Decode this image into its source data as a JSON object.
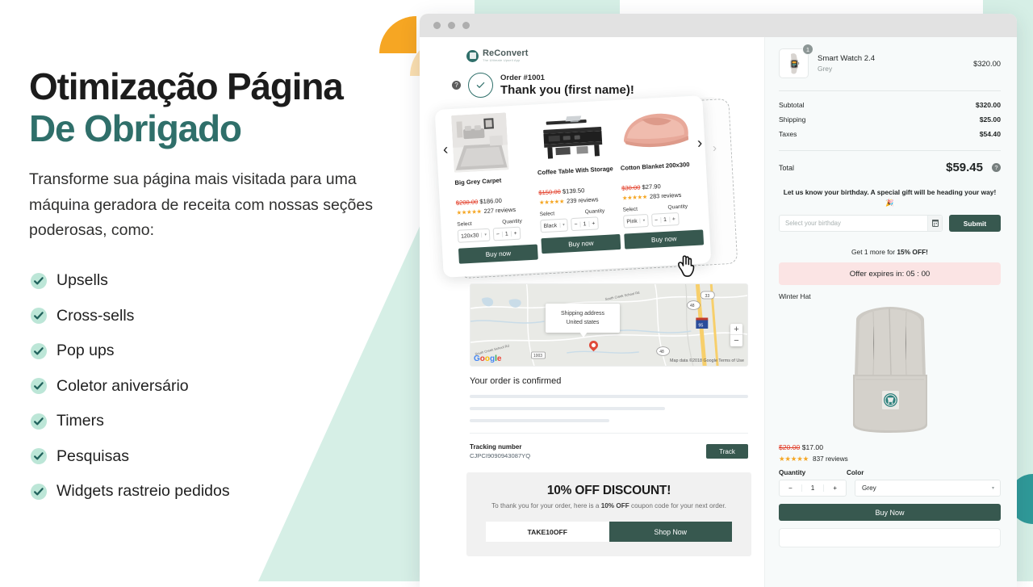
{
  "colors": {
    "teal": "#2f6f6a",
    "dark_green_button": "#37584f",
    "mint_bg": "#d6efe6",
    "ochre": "#f6a623",
    "ochre_light": "#fbdfb0",
    "teal_accent": "#2f9a99",
    "sale_red": "#e23b26",
    "star_orange": "#f5a623",
    "offer_pink": "#fbe4e4"
  },
  "marketing": {
    "headline_line1": "Otimização Página",
    "headline_line2": "De Obrigado",
    "subcopy": "Transforme sua página mais visitada para uma máquina geradora de receita com nossas seções poderosas, como:",
    "features": [
      {
        "label": "Upsells",
        "icon": "check-icon"
      },
      {
        "label": "Cross-sells",
        "icon": "check-icon"
      },
      {
        "label": "Pop ups",
        "icon": "check-icon"
      },
      {
        "label": "Coletor aniversário",
        "icon": "check-icon"
      },
      {
        "label": "Timers",
        "icon": "check-icon"
      },
      {
        "label": "Pesquisas",
        "icon": "check-icon"
      },
      {
        "label": "Widgets rastreio pedidos",
        "icon": "check-icon"
      }
    ]
  },
  "browser": {
    "chrome_dots": 3
  },
  "thankyou_page": {
    "brand": {
      "name": "ReConvert",
      "tagline": "The Ultimate Upsell App"
    },
    "help_icon": "question-mark-icon",
    "status_icon": "check-circle-icon",
    "order_number": "Order #1001",
    "thank_you_heading": "Thank you (first name)!",
    "carousel": {
      "prev_label": "‹",
      "next_label": "›",
      "ghost_next_label": "›",
      "products": [
        {
          "name": "Big Grey Carpet",
          "price_was": "$200.00",
          "price_now": "$186.00",
          "stars": "★★★★★",
          "reviews": "227 reviews",
          "select_label": "Select",
          "select_value": "120x30",
          "quantity_label": "Quantity",
          "quantity_value": "1",
          "minus": "−",
          "plus": "+",
          "buy_label": "Buy now",
          "image": "grey-carpet-room-photo"
        },
        {
          "name": "Coffee Table With Storage",
          "price_was": "$150.00",
          "price_now": "$139.50",
          "stars": "★★★★★",
          "reviews": "239 reviews",
          "select_label": "Select",
          "select_value": "Black",
          "quantity_label": "Quantity",
          "quantity_value": "1",
          "minus": "−",
          "plus": "+",
          "buy_label": "Buy now",
          "image": "black-coffee-table-photo"
        },
        {
          "name": "Cotton Blanket 200x300",
          "price_was": "$30.00",
          "price_now": "$27.90",
          "stars": "★★★★★",
          "reviews": "283 reviews",
          "select_label": "Select",
          "select_value": "Pink",
          "quantity_label": "Quantity",
          "quantity_value": "1",
          "minus": "−",
          "plus": "+",
          "buy_label": "Buy now",
          "image": "pink-folded-blanket-photo"
        }
      ]
    },
    "map": {
      "callout_line1": "Shipping address",
      "callout_line2": "United states",
      "logo": "Google",
      "attribution": "Map data ©2018 Google      Terms of Use",
      "zoom_in": "+",
      "zoom_out": "−",
      "pin_icon": "map-pin-icon"
    },
    "confirmation": {
      "title": "Your order is confirmed",
      "tracking_label": "Tracking number",
      "tracking_code": "CJPCI9090943087YQ",
      "track_button": "Track"
    },
    "discount": {
      "title": "10% OFF DISCOUNT!",
      "sub_pre": "To thank you for your order, here is a ",
      "sub_bold": "10% OFF",
      "sub_post": " coupon code for your next order.",
      "coupon_code": "TAKE10OFF",
      "shop_button": "Shop Now"
    }
  },
  "order_summary": {
    "line_item": {
      "badge_qty": "1",
      "name": "Smart Watch 2.4",
      "variant": "Grey",
      "price": "$320.00",
      "image": "smart-watch-photo"
    },
    "totals": [
      {
        "key": "Subtotal",
        "value": "$320.00"
      },
      {
        "key": "Shipping",
        "value": "$25.00"
      },
      {
        "key": "Taxes",
        "value": "$54.40"
      }
    ],
    "total_label": "Total",
    "total_value": "$59.45",
    "total_info_icon": "question-mark-icon",
    "birthday": {
      "copy": "Let us know your birthday. A special gift will be heading your way! 🎉",
      "placeholder": "Select your birthday",
      "calendar_icon": "calendar-icon",
      "submit_label": "Submit"
    },
    "upsell": {
      "get_more_pre": "Get 1 more for ",
      "get_more_bold": "15% OFF!",
      "offer_text": "Offer expires in: 05 : 00",
      "product_name": "Winter Hat",
      "image": "grey-winter-beanie-photo",
      "price_was": "$20.00",
      "price_now": "$17.00",
      "stars": "★★★★★",
      "reviews": "837 reviews",
      "quantity_label": "Quantity",
      "quantity_value": "1",
      "minus": "−",
      "plus": "+",
      "color_label": "Color",
      "color_value": "Grey",
      "buy_label": "Buy Now"
    }
  }
}
